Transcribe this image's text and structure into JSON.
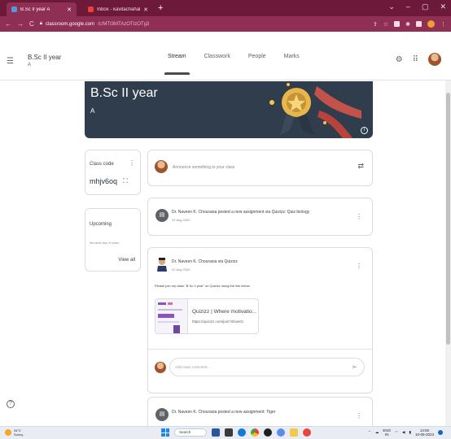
{
  "browser": {
    "tabs": [
      {
        "label": "B.Sc II year A",
        "active": true
      },
      {
        "label": "Inbox - kavitachahal08@gmail.c",
        "active": false
      }
    ],
    "new_tab": "+",
    "url_host": "classroom.google.com",
    "url_path": "/c/MTI3MTAzOTIzOTg3",
    "window_controls": [
      "⌄",
      "–",
      "▢",
      "✕"
    ]
  },
  "header": {
    "class_name": "B.Sc II year",
    "section": "A",
    "tabs": [
      "Stream",
      "Classwork",
      "People",
      "Marks"
    ],
    "active_tab": "Stream"
  },
  "banner": {
    "title": "B.Sc II year",
    "section": "A",
    "info": "i"
  },
  "class_code": {
    "label": "Class code",
    "code": "mhjv6oq"
  },
  "upcoming": {
    "label": "Upcoming",
    "empty_text": "No work due in soon",
    "view_all": "View all"
  },
  "announce": {
    "placeholder": "Announce something to your class"
  },
  "posts": [
    {
      "title": "Dr. Naveen K. Chourasia posted a new assignment via Quizizz: Quiz biology",
      "date": "22 Aug 2020"
    },
    {
      "title": "Dr. Naveen K. Chourasia via Quizizz",
      "date": "22 Aug 2020",
      "body": "Please join my class \"B.Sc II year\" on Quizizz using the link below.",
      "attachment": {
        "title": "Quizizz | Where motivatio...",
        "url": "https://quizizz.com/join?showGr"
      },
      "comment_placeholder": "Add class comment..."
    },
    {
      "title": "Dr. Naveen K. Chourasia posted a new assignment: Tiger"
    }
  ],
  "taskbar": {
    "temp": "34°C",
    "weather": "Sunny",
    "search": "Search",
    "lang": "ENG",
    "region": "IN",
    "time": "14:50",
    "date": "10-09-2023"
  },
  "colors": {
    "browser_frame": "#8f2f54",
    "banner": "#2f3d4c",
    "accent_tab": "#4a4a4a"
  }
}
